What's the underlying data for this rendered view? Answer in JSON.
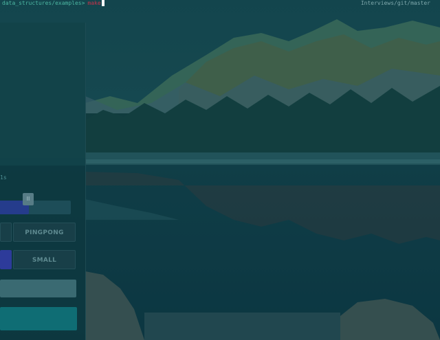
{
  "terminal": {
    "path": "data_structures/examples>",
    "command": "make",
    "git_info": "Interviews/git/master"
  },
  "panel": {
    "speed_value": "1s",
    "slider_thumb_glyph": "II",
    "slider_level": 0.4,
    "buttons": {
      "mode": "PINGPONG",
      "size": "SMALL"
    }
  },
  "colors": {
    "prompt_path": "#4cb7a2",
    "prompt_command": "#c8324a",
    "accent": "#2d3b9a",
    "teal_bar": "#0f6d74"
  },
  "icons": {
    "slider_thumb": "pause-icon"
  }
}
